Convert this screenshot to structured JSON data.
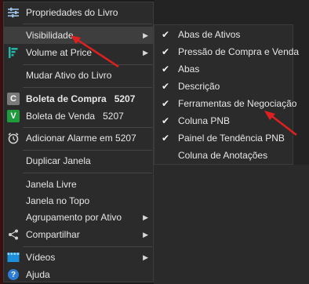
{
  "menu": {
    "items": [
      {
        "label": "Propriedades do Livro",
        "icon": "settings-sliders-icon"
      },
      {
        "label": "Visibilidade",
        "icon": "",
        "submenu": true
      },
      {
        "label": "Volume at Price",
        "icon": "volume-at-price-icon",
        "submenu": true
      },
      {
        "label": "Mudar Ativo do Livro"
      },
      {
        "label": "Boleta de Compra",
        "shortcut": "5207",
        "icon": "C"
      },
      {
        "label": "Boleta de Venda",
        "shortcut": "5207",
        "icon": "V"
      },
      {
        "label": "Adicionar Alarme em 5207",
        "icon": "alarm-clock-icon"
      },
      {
        "label": "Duplicar Janela"
      },
      {
        "label": "Janela Livre"
      },
      {
        "label": "Janela no Topo"
      },
      {
        "label": "Agrupamento por Ativo",
        "submenu": true
      },
      {
        "label": "Compartilhar",
        "icon": "share-icon",
        "submenu": true
      },
      {
        "label": "Vídeos",
        "icon": "video-icon",
        "submenu": true
      },
      {
        "label": "Ajuda",
        "icon": "?"
      }
    ]
  },
  "submenu": {
    "items": [
      {
        "label": "Abas de Ativos",
        "checked": true
      },
      {
        "label": "Pressão de Compra e Venda",
        "checked": true
      },
      {
        "label": "Abas",
        "checked": true
      },
      {
        "label": "Descrição",
        "checked": true
      },
      {
        "label": "Ferramentas de Negociação",
        "checked": true
      },
      {
        "label": "Coluna PNB",
        "checked": true
      },
      {
        "label": "Painel de Tendência PNB",
        "checked": true
      },
      {
        "label": "Coluna de Anotações",
        "checked": false
      }
    ]
  },
  "colors": {
    "annotation_arrow": "#e02020",
    "accent_green": "#1f9a3d",
    "help_blue": "#2e7bd6"
  }
}
